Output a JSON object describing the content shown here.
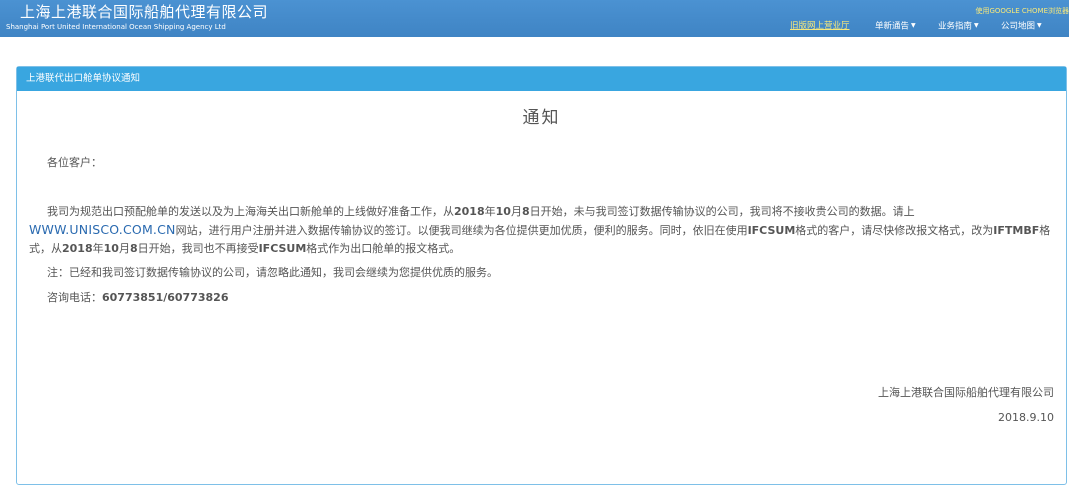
{
  "header": {
    "brand_cn": "上海上港联合国际船舶代理有限公司",
    "brand_en": "Shanghai Port United International Ocean Shipping Agency Ltd",
    "chrome_note": "使用GOOGLE CHOME浏览器",
    "nav": [
      {
        "label": "旧版网上营业厅",
        "highlight": true,
        "dropdown": false
      },
      {
        "label": "单新通告",
        "highlight": false,
        "dropdown": true
      },
      {
        "label": "业务指南",
        "highlight": false,
        "dropdown": true
      },
      {
        "label": "公司地图",
        "highlight": false,
        "dropdown": true
      }
    ]
  },
  "panel": {
    "header": "上港联代出口舱单协议通知",
    "title": "通知",
    "greeting": "各位客户：",
    "body": {
      "part1": "我司为规范出口预配舱单的发送以及为上海海关出口新舱单的上线做好准备工作，从",
      "date1": "2018",
      "part1b": "年",
      "part1c": "10",
      "part1d": "月",
      "part1e": "8",
      "part1f": "日开始，未与我司签订数据传输协议的公司，我司将不接收贵公司的数据。请上",
      "link": "WWW.UNISCO.COM.CN",
      "part2": "网站，进行用户注册并进入数据传输协议的签订。以便我司继续为各位提供更加优质，便利的服务。同时，依旧在使用",
      "format_old": "IFCSUM",
      "part3": "格式的客户，请尽快修改报文格式，改为",
      "format_new": "IFTMBF",
      "part4": "格式，从",
      "date2": "2018",
      "part4b": "年",
      "part4c": "10",
      "part4d": "月",
      "part4e": "8",
      "part4f": "日开始，我司也不再接受",
      "format_old2": "IFCSUM",
      "part5": "格式作为出口舱单的报文格式。"
    },
    "note": "注：已经和我司签订数据传输协议的公司，请忽略此通知，我司会继续为您提供优质的服务。",
    "phone_label": "咨询电话：",
    "phone_number": "60773851/60773826",
    "company": "上海上港联合国际船舶代理有限公司",
    "date": "2018.9.10"
  }
}
